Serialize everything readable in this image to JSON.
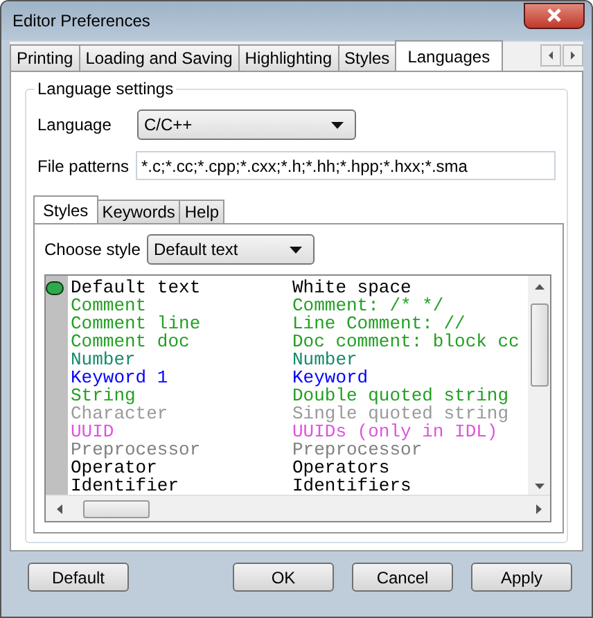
{
  "window": {
    "title": "Editor Preferences"
  },
  "tabs": [
    {
      "label": "Printing",
      "selected": false
    },
    {
      "label": "Loading and Saving",
      "selected": false
    },
    {
      "label": "Highlighting",
      "selected": false
    },
    {
      "label": "Styles",
      "selected": false
    },
    {
      "label": "Languages",
      "selected": true
    }
  ],
  "group": {
    "title": "Language settings",
    "language_label": "Language",
    "language_value": "C/C++",
    "patterns_label": "File patterns",
    "patterns_value": "*.c;*.cc;*.cpp;*.cxx;*.h;*.hh;*.hpp;*.hxx;*.sma"
  },
  "inner_tabs": [
    {
      "label": "Styles",
      "selected": true
    },
    {
      "label": "Keywords",
      "selected": false
    },
    {
      "label": "Help",
      "selected": false
    }
  ],
  "choose_style": {
    "label": "Choose style",
    "value": "Default text"
  },
  "styles": [
    {
      "name": "Default text",
      "description": "White space",
      "color": "#000000",
      "selected": true
    },
    {
      "name": "Comment",
      "description": "Comment: /* */",
      "color": "#22a022",
      "selected": false
    },
    {
      "name": "Comment line",
      "description": "Line Comment: //",
      "color": "#22a022",
      "selected": false
    },
    {
      "name": "Comment doc",
      "description": "Doc comment: block cc",
      "color": "#22a022",
      "selected": false
    },
    {
      "name": "Number",
      "description": "Number",
      "color": "#158a6a",
      "selected": false
    },
    {
      "name": "Keyword 1",
      "description": "Keyword",
      "color": "#0000ff",
      "selected": false
    },
    {
      "name": "String",
      "description": "Double quoted string",
      "color": "#22a022",
      "selected": false
    },
    {
      "name": "Character",
      "description": "Single quoted string",
      "color": "#9a9a9a",
      "selected": false
    },
    {
      "name": "UUID",
      "description": "UUIDs (only in IDL)",
      "color": "#dd55dd",
      "selected": false
    },
    {
      "name": "Preprocessor",
      "description": "Preprocessor",
      "color": "#808080",
      "selected": false
    },
    {
      "name": "Operator",
      "description": "Operators",
      "color": "#000000",
      "selected": false
    },
    {
      "name": "Identifier",
      "description": "Identifiers",
      "color": "#000000",
      "selected": false
    }
  ],
  "buttons": [
    {
      "label": "Default"
    },
    {
      "label": "OK"
    },
    {
      "label": "Cancel"
    },
    {
      "label": "Apply"
    }
  ]
}
